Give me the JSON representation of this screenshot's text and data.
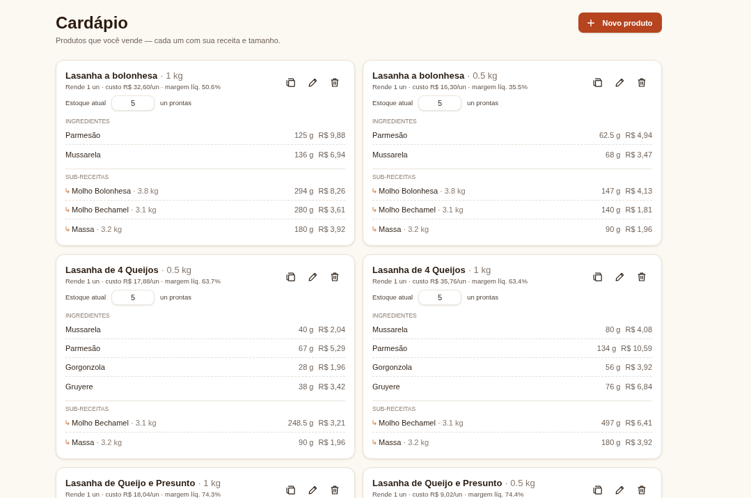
{
  "header": {
    "title": "Cardápio",
    "subtitle": "Produtos que você vende — cada um com sua receita e tamanho.",
    "new_button": {
      "label": "Novo produto"
    }
  },
  "products": [
    {
      "name": "Lasanha a bolonhesa",
      "size": "· 1 kg",
      "summary": "Rende 1 un · custo R$ 32,60/un · margem líq. 50.6%",
      "stock": {
        "label": "Estoque atual",
        "value": "5",
        "unit": "un prontas"
      },
      "ingredients_label": "INGREDIENTES",
      "ingredients": [
        {
          "name": "Parmesão",
          "quantity": "125 g",
          "cost": "R$ 9,88"
        },
        {
          "name": "Mussarela",
          "quantity": "136 g",
          "cost": "R$ 6,94"
        }
      ],
      "subrecipes_label": "SUB-RECEITAS",
      "subrecipes": [
        {
          "name": "Molho Bolonhesa",
          "size": "· 3.8 kg",
          "quantity": "294 g",
          "cost": "R$ 8,26"
        },
        {
          "name": "Molho Bechamel",
          "size": "· 3.1 kg",
          "quantity": "280 g",
          "cost": "R$ 3,61"
        },
        {
          "name": "Massa",
          "size": "· 3.2 kg",
          "quantity": "180 g",
          "cost": "R$ 3,92"
        }
      ]
    },
    {
      "name": "Lasanha a bolonhesa",
      "size": "· 0.5 kg",
      "summary": "Rende 1 un · custo R$ 16,30/un · margem líq. 35.5%",
      "stock": {
        "label": "Estoque atual",
        "value": "5",
        "unit": "un prontas"
      },
      "ingredients_label": "INGREDIENTES",
      "ingredients": [
        {
          "name": "Parmesão",
          "quantity": "62.5 g",
          "cost": "R$ 4,94"
        },
        {
          "name": "Mussarela",
          "quantity": "68 g",
          "cost": "R$ 3,47"
        }
      ],
      "subrecipes_label": "SUB-RECEITAS",
      "subrecipes": [
        {
          "name": "Molho Bolonhesa",
          "size": "· 3.8 kg",
          "quantity": "147 g",
          "cost": "R$ 4,13"
        },
        {
          "name": "Molho Bechamel",
          "size": "· 3.1 kg",
          "quantity": "140 g",
          "cost": "R$ 1,81"
        },
        {
          "name": "Massa",
          "size": "· 3.2 kg",
          "quantity": "90 g",
          "cost": "R$ 1,96"
        }
      ]
    },
    {
      "name": "Lasanha de 4 Queijos",
      "size": "· 0.5 kg",
      "summary": "Rende 1 un · custo R$ 17,88/un · margem líq. 63.7%",
      "stock": {
        "label": "Estoque atual",
        "value": "5",
        "unit": "un prontas"
      },
      "ingredients_label": "INGREDIENTES",
      "ingredients": [
        {
          "name": "Mussarela",
          "quantity": "40 g",
          "cost": "R$ 2,04"
        },
        {
          "name": "Parmesão",
          "quantity": "67 g",
          "cost": "R$ 5,29"
        },
        {
          "name": "Gorgonzola",
          "quantity": "28 g",
          "cost": "R$ 1,96"
        },
        {
          "name": "Gruyere",
          "quantity": "38 g",
          "cost": "R$ 3,42"
        }
      ],
      "subrecipes_label": "SUB-RECEITAS",
      "subrecipes": [
        {
          "name": "Molho Bechamel",
          "size": "· 3.1 kg",
          "quantity": "248.5 g",
          "cost": "R$ 3,21"
        },
        {
          "name": "Massa",
          "size": "· 3.2 kg",
          "quantity": "90 g",
          "cost": "R$ 1,96"
        }
      ]
    },
    {
      "name": "Lasanha de 4 Queijos",
      "size": "· 1 kg",
      "summary": "Rende 1 un · custo R$ 35,76/un · margem líq. 63.4%",
      "stock": {
        "label": "Estoque atual",
        "value": "5",
        "unit": "un prontas"
      },
      "ingredients_label": "INGREDIENTES",
      "ingredients": [
        {
          "name": "Mussarela",
          "quantity": "80 g",
          "cost": "R$ 4,08"
        },
        {
          "name": "Parmesão",
          "quantity": "134 g",
          "cost": "R$ 10,59"
        },
        {
          "name": "Gorgonzola",
          "quantity": "56 g",
          "cost": "R$ 3,92"
        },
        {
          "name": "Gruyere",
          "quantity": "76 g",
          "cost": "R$ 6,84"
        }
      ],
      "subrecipes_label": "SUB-RECEITAS",
      "subrecipes": [
        {
          "name": "Molho Bechamel",
          "size": "· 3.1 kg",
          "quantity": "497 g",
          "cost": "R$ 6,41"
        },
        {
          "name": "Massa",
          "size": "· 3.2 kg",
          "quantity": "180 g",
          "cost": "R$ 3,92"
        }
      ]
    },
    {
      "name": "Lasanha de Queijo e Presunto",
      "size": "· 1 kg",
      "summary": "Rende 1 un · custo R$ 18,04/un · margem líq. 74.3%"
    },
    {
      "name": "Lasanha de Queijo e Presunto",
      "size": "· 0.5 kg",
      "summary": "Rende 1 un · custo R$ 9,02/un · margem líq. 74.4%"
    }
  ]
}
